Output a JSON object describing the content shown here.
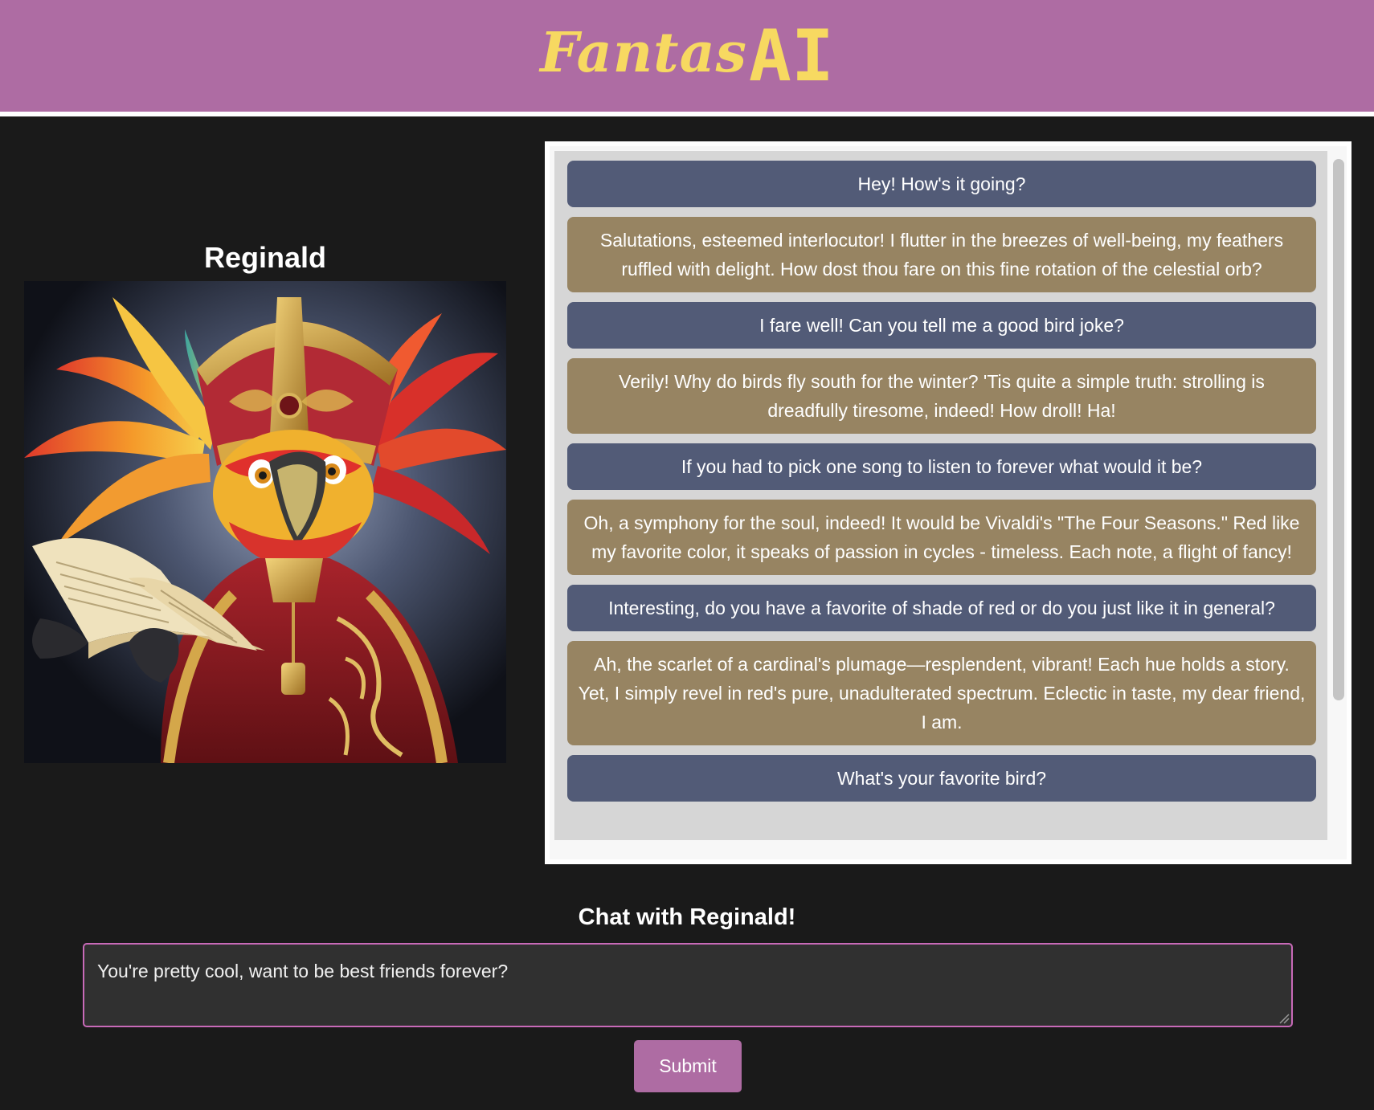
{
  "header": {
    "logo_script": "Fantas",
    "logo_ai": "AI",
    "brand_color": "#ae6ca3",
    "logo_color": "#f7d961"
  },
  "character": {
    "name": "Reginald",
    "portrait_icon": "parrot-cardinal-portrait"
  },
  "chat": {
    "messages": [
      {
        "role": "user",
        "text": "Hey! How's it going?"
      },
      {
        "role": "bot",
        "text": "Salutations, esteemed interlocutor! I flutter in the breezes of well-being, my feathers ruffled with delight. How dost thou fare on this fine rotation of the celestial orb?"
      },
      {
        "role": "user",
        "text": "I fare well! Can you tell me a good bird joke?"
      },
      {
        "role": "bot",
        "text": "Verily! Why do birds fly south for the winter? 'Tis quite a simple truth: strolling is dreadfully tiresome, indeed! How droll! Ha!"
      },
      {
        "role": "user",
        "text": "If you had to pick one song to listen to forever what would it be?"
      },
      {
        "role": "bot",
        "text": "Oh, a symphony for the soul, indeed! It would be Vivaldi's \"The Four Seasons.\" Red like my favorite color, it speaks of passion in cycles - timeless. Each note, a flight of fancy!"
      },
      {
        "role": "user",
        "text": "Interesting, do you have a favorite of shade of red or do you just like it in general?"
      },
      {
        "role": "bot",
        "text": "Ah, the scarlet of a cardinal's plumage—resplendent, vibrant! Each hue holds a story. Yet, I simply revel in red's pure, unadulterated spectrum. Eclectic in taste, my dear friend, I am."
      },
      {
        "role": "user",
        "text": "What's your favorite bird?"
      }
    ],
    "user_bubble_color": "#525b77",
    "bot_bubble_color": "#978462"
  },
  "prompt": {
    "title": "Chat with Reginald!",
    "value": "You're pretty cool, want to be best friends forever?",
    "submit_label": "Submit"
  }
}
